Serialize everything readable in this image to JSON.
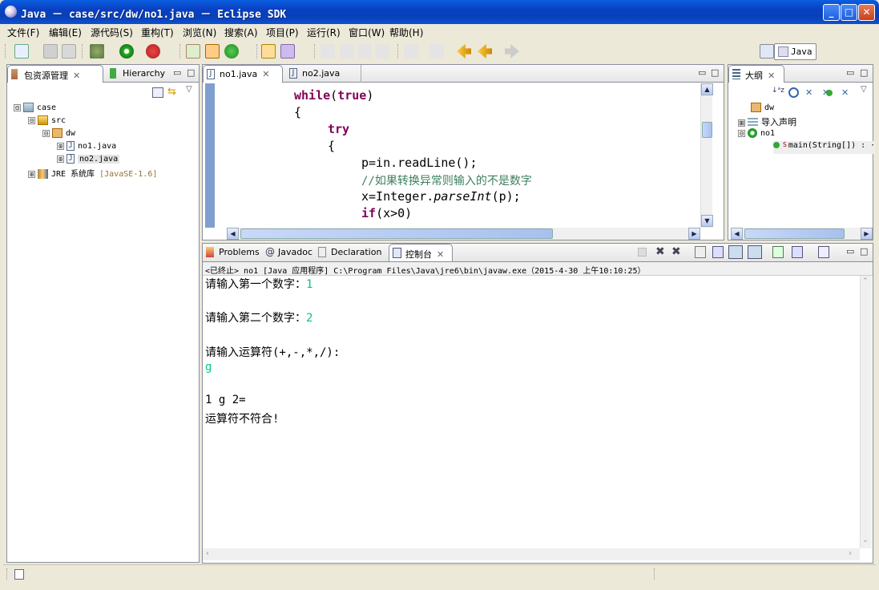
{
  "window": {
    "title": "Java － case/src/dw/no1.java － Eclipse SDK",
    "minimize": "_",
    "maximize": "□",
    "close": "✕"
  },
  "menu": [
    "文件(F)",
    "编辑(E)",
    "源代码(S)",
    "重构(T)",
    "浏览(N)",
    "搜索(A)",
    "项目(P)",
    "运行(R)",
    "窗口(W)",
    "帮助(H)"
  ],
  "perspective": {
    "label": "Java"
  },
  "explorer": {
    "tab_label": "包资源管理",
    "hierarchy_label": "Hierarchy",
    "tree": [
      {
        "label": "case",
        "expander": "⊟"
      },
      {
        "label": "src",
        "expander": "⊟"
      },
      {
        "label": "dw",
        "expander": "⊟"
      },
      {
        "label": "no1.java",
        "expander": "⊞"
      },
      {
        "label": "no2.java",
        "expander": "⊞"
      },
      {
        "label": "JRE 系统库",
        "suffix": "[JavaSE-1.6]",
        "expander": "⊞"
      }
    ]
  },
  "editor": {
    "tabs": [
      "no1.java",
      "no2.java"
    ],
    "lines": [
      {
        "kw": "while",
        "rest": "(",
        "kw2": "true",
        "rest2": ")"
      },
      {
        "text": "{"
      },
      {
        "kw": "try"
      },
      {
        "text": "{"
      },
      {
        "text": "p=in.readLine();"
      },
      {
        "comment": "//如果转换异常则输入的不是数字"
      },
      {
        "pre": "x=Integer.",
        "italic": "parseInt",
        "post": "(p);"
      },
      {
        "kw": "if",
        "rest": "(x>0)"
      }
    ]
  },
  "outline": {
    "tab_label": "大纲",
    "items": [
      {
        "label": "dw",
        "expander": ""
      },
      {
        "label": "导入声明",
        "expander": "⊞"
      },
      {
        "label": "no1",
        "expander": "⊟"
      },
      {
        "label": "main(String[]) : ·",
        "expander": ""
      }
    ]
  },
  "bottom_tabs": {
    "problems": "Problems",
    "javadoc": "Javadoc",
    "declaration": "Declaration",
    "console": "控制台"
  },
  "console": {
    "header": "<已终止> no1 [Java 应用程序] C:\\Program Files\\Java\\jre6\\bin\\javaw.exe（2015-4-30 上午10:10:25）",
    "prompt1": "请输入第一个数字：",
    "input1": "1",
    "prompt2": "请输入第二个数字：",
    "input2": "2",
    "prompt3": "请输入运算符(+,-,*,/):",
    "input3": "g",
    "result": "1 g 2=",
    "error": "运算符不符合!"
  },
  "colors": {
    "keyword": "#7f0055",
    "comment": "#3f7f5f",
    "console_input": "#00c87f",
    "titlebar": "#0a4fd0"
  }
}
